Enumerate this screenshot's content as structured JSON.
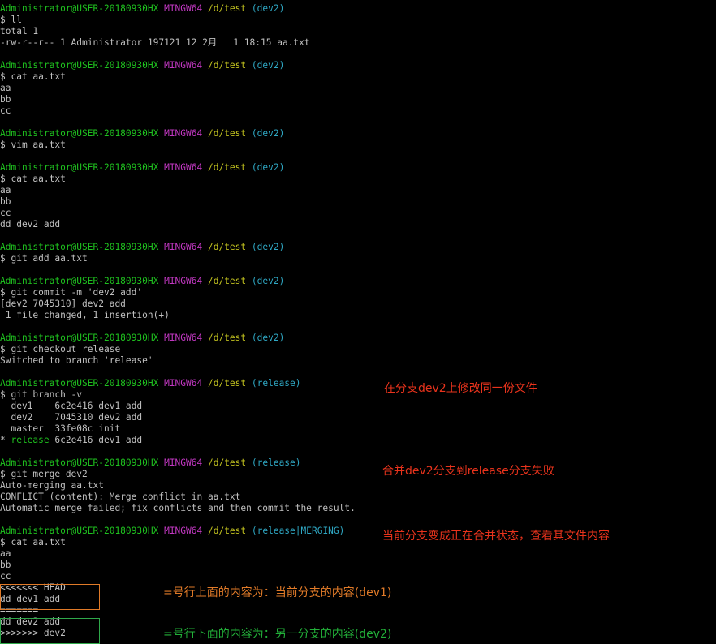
{
  "prompt": {
    "user_host": "Administrator@USER-20180930HX",
    "system": "MINGW64",
    "path": "/d/test"
  },
  "lines": [
    {
      "type": "prompt",
      "branch": "(dev2)"
    },
    {
      "type": "text",
      "text": "$ ll"
    },
    {
      "type": "text",
      "text": "total 1"
    },
    {
      "type": "text",
      "text": "-rw-r--r-- 1 Administrator 197121 12 2月   1 18:15 aa.txt"
    },
    {
      "type": "blank"
    },
    {
      "type": "prompt",
      "branch": "(dev2)"
    },
    {
      "type": "text",
      "text": "$ cat aa.txt"
    },
    {
      "type": "text",
      "text": "aa"
    },
    {
      "type": "text",
      "text": "bb"
    },
    {
      "type": "text",
      "text": "cc"
    },
    {
      "type": "blank"
    },
    {
      "type": "prompt",
      "branch": "(dev2)"
    },
    {
      "type": "text",
      "text": "$ vim aa.txt"
    },
    {
      "type": "blank"
    },
    {
      "type": "prompt",
      "branch": "(dev2)"
    },
    {
      "type": "text",
      "text": "$ cat aa.txt"
    },
    {
      "type": "text",
      "text": "aa"
    },
    {
      "type": "text",
      "text": "bb"
    },
    {
      "type": "text",
      "text": "cc"
    },
    {
      "type": "text",
      "text": "dd dev2 add"
    },
    {
      "type": "blank"
    },
    {
      "type": "prompt",
      "branch": "(dev2)"
    },
    {
      "type": "text",
      "text": "$ git add aa.txt"
    },
    {
      "type": "blank"
    },
    {
      "type": "prompt",
      "branch": "(dev2)"
    },
    {
      "type": "text",
      "text": "$ git commit -m 'dev2 add'"
    },
    {
      "type": "text",
      "text": "[dev2 7045310] dev2 add"
    },
    {
      "type": "text",
      "text": " 1 file changed, 1 insertion(+)"
    },
    {
      "type": "blank"
    },
    {
      "type": "prompt",
      "branch": "(dev2)"
    },
    {
      "type": "text",
      "text": "$ git checkout release"
    },
    {
      "type": "text",
      "text": "Switched to branch 'release'"
    },
    {
      "type": "blank"
    },
    {
      "type": "prompt",
      "branch": "(release)"
    },
    {
      "type": "text",
      "text": "$ git branch -v"
    },
    {
      "type": "text",
      "text": "  dev1    6c2e416 dev1 add"
    },
    {
      "type": "text",
      "text": "  dev2    7045310 dev2 add"
    },
    {
      "type": "text",
      "text": "  master  33fe08c init"
    },
    {
      "type": "current",
      "star": "* ",
      "name": "release",
      "rest": " 6c2e416 dev1 add"
    },
    {
      "type": "blank"
    },
    {
      "type": "prompt",
      "branch": "(release)"
    },
    {
      "type": "text",
      "text": "$ git merge dev2"
    },
    {
      "type": "text",
      "text": "Auto-merging aa.txt"
    },
    {
      "type": "text",
      "text": "CONFLICT (content): Merge conflict in aa.txt"
    },
    {
      "type": "text",
      "text": "Automatic merge failed; fix conflicts and then commit the result."
    },
    {
      "type": "blank"
    },
    {
      "type": "prompt",
      "branch": "(release|MERGING)"
    },
    {
      "type": "text",
      "text": "$ cat aa.txt"
    },
    {
      "type": "text",
      "text": "aa"
    },
    {
      "type": "text",
      "text": "bb"
    },
    {
      "type": "text",
      "text": "cc"
    },
    {
      "type": "text",
      "text": "<<<<<<< HEAD"
    },
    {
      "type": "text",
      "text": "dd dev1 add"
    },
    {
      "type": "text",
      "text": "======="
    },
    {
      "type": "text",
      "text": "dd dev2 add"
    },
    {
      "type": "text",
      "text": ">>>>>>> dev2"
    }
  ],
  "annotations": {
    "modify_note": "在分支dev2上修改同一份文件",
    "merge_fail_note": "合并dev2分支到release分支失败",
    "merging_state_note": "当前分支变成正在合并状态，查看其文件内容",
    "above_note": "=号行上面的内容为：当前分支的内容(dev1)",
    "below_note": "=号行下面的内容为：另一分支的内容(dev2)"
  },
  "colors": {
    "background": "#000000",
    "text": "#c0c0c0",
    "user_host": "#1fc21f",
    "system": "#c238c2",
    "path": "#c2c21f",
    "branch": "#2fa8c4",
    "annotation_red": "#e8331c",
    "annotation_orange": "#e07a28",
    "annotation_green": "#22b039"
  }
}
